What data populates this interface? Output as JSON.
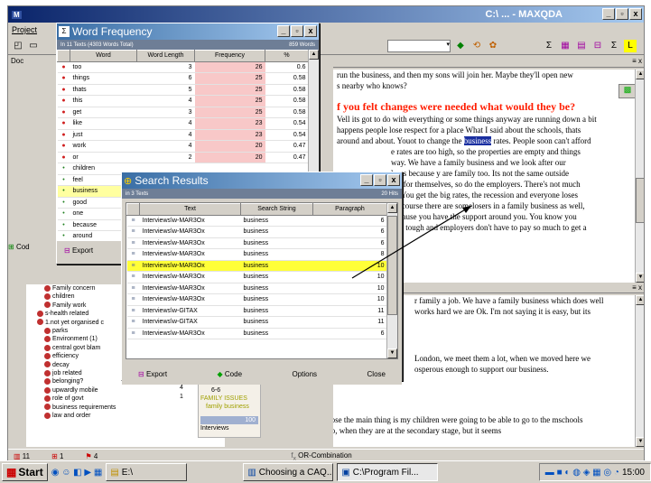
{
  "main_window": {
    "title": "C:\\ ... - MAXQDA",
    "menu": [
      "Project"
    ],
    "doc_panel_label": "Doc",
    "code_panel_label": "Cod"
  },
  "code_tree": [
    {
      "label": "Family concern",
      "indent": 2
    },
    {
      "label": "children",
      "indent": 2
    },
    {
      "label": "Family work",
      "indent": 2
    },
    {
      "label": "s-health related",
      "indent": 1
    },
    {
      "label": "1.not yet organised c",
      "indent": 1
    },
    {
      "label": "parks",
      "indent": 2
    },
    {
      "label": "Environment (1)",
      "indent": 2
    },
    {
      "label": "central govt blam",
      "indent": 2
    },
    {
      "label": "efficiency",
      "indent": 2
    },
    {
      "label": "decay",
      "indent": 2
    },
    {
      "label": "job related",
      "indent": 2
    },
    {
      "label": "belonging?",
      "indent": 2
    },
    {
      "label": "upwardly mobile",
      "indent": 2
    },
    {
      "label": "role of govt",
      "indent": 2
    },
    {
      "label": "business requirements",
      "indent": 2
    },
    {
      "label": "law and order",
      "indent": 2
    }
  ],
  "code_tree_counts": [
    "1",
    "1",
    "1",
    "4",
    "1"
  ],
  "doc_text": {
    "line1": "run the business, and then my sons will join her.  Maybe they'll open new",
    "line2": "s nearby who knows?",
    "heading": "f you felt changes were needed what would they be?",
    "p1a": "Vell its got to do with everything or some things anyway are running down a bit",
    "p1b": "happens people lose respect for a place  What I said about the schools, thats",
    "p1c_pre": "around and about. Youot to change the ",
    "p1c_hl": "business",
    "p1c_post": " rates. People soon can't afford",
    "p1d": "e rates are too high, so the properties are  empty and things",
    "p1e": "way.  We have a family  business and we look after our",
    "p1f": "lp us because  y are family too.  Its not the same outside",
    "p1g": "out for themselves, so do the employers.  There's not much",
    "p1h": "py  You get the big rates, the recession and  everyone loses",
    "p1i": "Of course there are somelosers in a family business as well,",
    "p1j": "because you have the support around you.  You know you",
    "p1k": "ting tough and employers don't have to pay so much to get a",
    "p2a": "r family a job.  We have a family  business which does well",
    "p2b": "works  hard we are Ok.  I'm not saying it is easy, but its",
    "p3a": "London, we meet them a lot,  when we moved here we",
    "p3b": "osperous enough to support our business.",
    "p4a": "GYA1: Well... I suppose the main thing is my children were going to be able  to go to the mschools",
    "p4b": "we want them to go to, when they are at the secondary stage, but it seems"
  },
  "word_frequency": {
    "title": "Word Frequency",
    "subtitle_left": "In 11 Texts  (4303 Words Total)",
    "subtitle_right": "859 Words",
    "columns": [
      "Word",
      "Word Length",
      "Frequency",
      "%"
    ],
    "rows": [
      {
        "word": "too",
        "len": "3",
        "freq": "26",
        "pct": "0.6"
      },
      {
        "word": "things",
        "len": "6",
        "freq": "25",
        "pct": "0.58"
      },
      {
        "word": "thats",
        "len": "5",
        "freq": "25",
        "pct": "0.58"
      },
      {
        "word": "this",
        "len": "4",
        "freq": "25",
        "pct": "0.58"
      },
      {
        "word": "get",
        "len": "3",
        "freq": "25",
        "pct": "0.58"
      },
      {
        "word": "like",
        "len": "4",
        "freq": "23",
        "pct": "0.54"
      },
      {
        "word": "just",
        "len": "4",
        "freq": "23",
        "pct": "0.54"
      },
      {
        "word": "work",
        "len": "4",
        "freq": "20",
        "pct": "0.47"
      },
      {
        "word": "or",
        "len": "2",
        "freq": "20",
        "pct": "0.47"
      },
      {
        "word": "children",
        "len": "",
        "freq": "",
        "pct": ""
      },
      {
        "word": "feel",
        "len": "",
        "freq": "",
        "pct": ""
      },
      {
        "word": "business",
        "len": "",
        "freq": "",
        "pct": ""
      },
      {
        "word": "good",
        "len": "",
        "freq": "",
        "pct": ""
      },
      {
        "word": "one",
        "len": "",
        "freq": "",
        "pct": ""
      },
      {
        "word": "because",
        "len": "",
        "freq": "",
        "pct": ""
      },
      {
        "word": "around",
        "len": "",
        "freq": "",
        "pct": ""
      }
    ],
    "export_label": "Export"
  },
  "search_results": {
    "title": "Search Results",
    "subtitle_left": "in 3 Texts",
    "subtitle_right": "20 Hits",
    "columns": [
      "Text",
      "Search String",
      "Paragraph"
    ],
    "rows": [
      {
        "text": "Interviews\\w-MAR3Ox",
        "search": "business",
        "para": "6"
      },
      {
        "text": "Interviews\\w-MAR3Ox",
        "search": "business",
        "para": "6"
      },
      {
        "text": "Interviews\\w-MAR3Ox",
        "search": "business",
        "para": "6"
      },
      {
        "text": "Interviews\\w-MAR3Ox",
        "search": "business",
        "para": "8"
      },
      {
        "text": "Interviews\\w-MAR3Ox",
        "search": "business",
        "para": "10"
      },
      {
        "text": "Interviews\\w-MAR3Ox",
        "search": "business",
        "para": "10"
      },
      {
        "text": "Interviews\\w-MAR3Ox",
        "search": "business",
        "para": "10"
      },
      {
        "text": "Interviews\\w-MAR3Ox",
        "search": "business",
        "para": "10"
      },
      {
        "text": "Interviews\\w-GITAX",
        "search": "business",
        "para": "11"
      },
      {
        "text": "Interviews\\w-GITAX",
        "search": "business",
        "para": "11"
      },
      {
        "text": "Interviews\\w-MAR3Ox",
        "search": "business",
        "para": "6"
      }
    ],
    "buttons": {
      "export": "Export",
      "code": "Code",
      "options": "Options",
      "close": "Close"
    }
  },
  "mini_panel": {
    "lines": [
      "6-6",
      "FAMILY ISSUES",
      "family business"
    ],
    "number": "100",
    "item": "Interviews"
  },
  "status": {
    "left1": "11",
    "left2": "1",
    "left3": "4",
    "combo": "OR-Combination"
  },
  "taskbar": {
    "start": "Start",
    "tasks": [
      "E:\\",
      "Choosing a CAQ...",
      "C:\\Program Fil..."
    ],
    "clock": "15:00"
  },
  "colors": {
    "highlight": "#ffff38",
    "freq_bar": "#f8c8c8",
    "heading": "#ff1d00",
    "title_grad": "#0a246a"
  }
}
